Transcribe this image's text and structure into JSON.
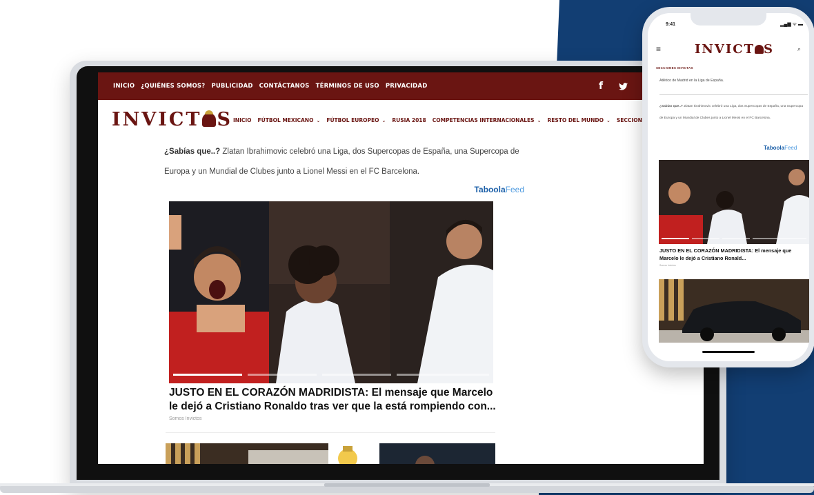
{
  "colors": {
    "brand": "#6a1512",
    "background_blue": "#123e73",
    "taboola_dark": "#1b5fa8",
    "taboola_light": "#4f9be0"
  },
  "laptop": {
    "topnav": [
      "INICIO",
      "¿QUIÉNES SOMOS?",
      "PUBLICIDAD",
      "CONTÁCTANOS",
      "TÉRMINOS DE USO",
      "PRIVACIDAD"
    ],
    "social": {
      "facebook": "f",
      "twitter": "🐦"
    },
    "logo": {
      "before": "INVICT",
      "after": "S"
    },
    "mainnav": [
      {
        "label": "INICIO",
        "caret": ""
      },
      {
        "label": "FÚTBOL MEXICANO",
        "caret": "⌄"
      },
      {
        "label": "FÚTBOL EUROPEO",
        "caret": "⌄"
      },
      {
        "label": "RUSIA 2018",
        "caret": ""
      },
      {
        "label": "COMPETENCIAS INTERNACIONALES",
        "caret": "⌄"
      },
      {
        "label": "RESTO DEL MUNDO",
        "caret": "⌄"
      },
      {
        "label": "SECCIONES",
        "caret": ""
      }
    ],
    "fact": {
      "lead": "¿Sabías que..?",
      "text": " Zlatan Ibrahimovic celebró una Liga, dos Supercopas de España, una Supercopa de Europa y un Mundial de Clubes junto a Lionel Messi en el FC Barcelona."
    },
    "taboola": {
      "brand": "Taboola",
      "feed": "Feed"
    },
    "article": {
      "headline": "JUSTO EN EL CORAZÓN MADRIDISTA: El mensaje que Marcelo le dejó a Cristiano Ronaldo tras ver que la está rompiendo con...",
      "source": "Somos Invictos"
    }
  },
  "phone": {
    "time": "9:41",
    "status_icons": "▂▄▆ ᯤ ▬",
    "menu_icon": "≡",
    "search_icon": "⌕",
    "logo": {
      "before": "INVICT",
      "after": "S"
    },
    "sections_label": "SECCIONES INVICTAS",
    "line1": "Atlético de Madrid en la Liga de España.",
    "fact": {
      "lead": "¿Sabías que..?",
      "text": " Zlatan Ibrahimovic celebró una Liga, dos Supercopas de España, una Supercopa de Europa y un Mundial de Clubes junto a Lionel Messi en el FC Barcelona."
    },
    "taboola": {
      "brand": "Taboola",
      "feed": "Feed"
    },
    "article": {
      "headline": "JUSTO EN EL CORAZÓN MADRIDISTA: El mensaje que Marcelo le dejó a Cristiano Ronald...",
      "source": "Somos Invictos"
    }
  }
}
